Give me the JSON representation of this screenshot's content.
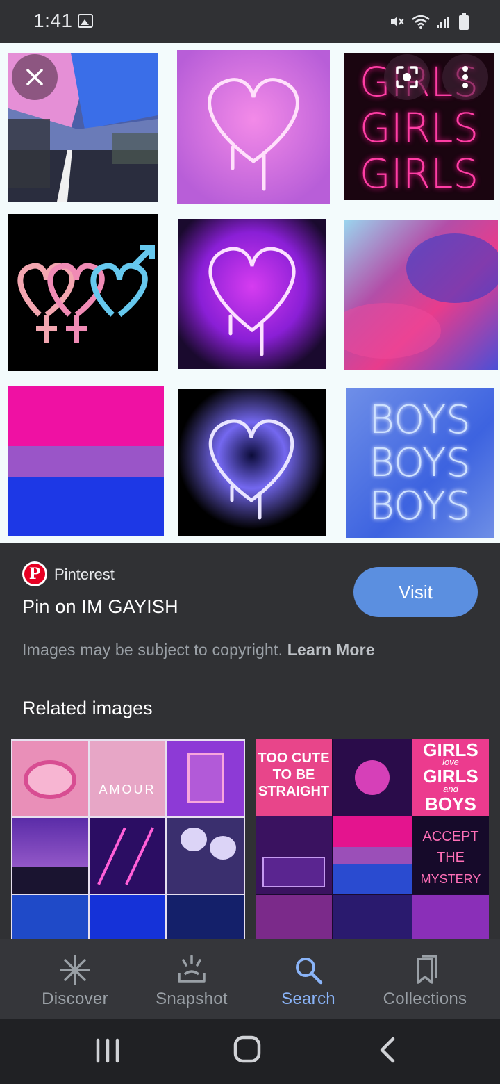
{
  "status_bar": {
    "time": "1:41"
  },
  "tiles": {
    "girls_text": [
      "GIRLS",
      "GIRLS",
      "GIRLS"
    ],
    "boys_text": [
      "BOYS",
      "BOYS",
      "BOYS"
    ]
  },
  "result": {
    "source": "Pinterest",
    "title": "Pin on IM GAYISH",
    "visit_label": "Visit",
    "copyright_text": "Images may be subject to copyright.",
    "learn_more_label": "Learn More"
  },
  "related": {
    "heading": "Related images",
    "left_collage_text": "AMOUR",
    "right_collage_text": {
      "too_cute": [
        "TOO CUTE",
        "TO BE",
        "STRAIGHT"
      ],
      "girls_love": [
        "GIRLS",
        "love",
        "GIRLS",
        "and",
        "BOYS"
      ],
      "accept": [
        "ACCEPT",
        "THE",
        "MYSTERY"
      ]
    }
  },
  "bottom_nav": {
    "items": [
      {
        "label": "Discover",
        "icon": "asterisk-icon"
      },
      {
        "label": "Snapshot",
        "icon": "snapshot-icon"
      },
      {
        "label": "Search",
        "icon": "search-icon",
        "active": true
      },
      {
        "label": "Collections",
        "icon": "bookmark-icon"
      }
    ]
  },
  "colors": {
    "accent": "#8ab4f8",
    "visit_button": "#5b8fe0",
    "pinterest_red": "#e60023"
  }
}
